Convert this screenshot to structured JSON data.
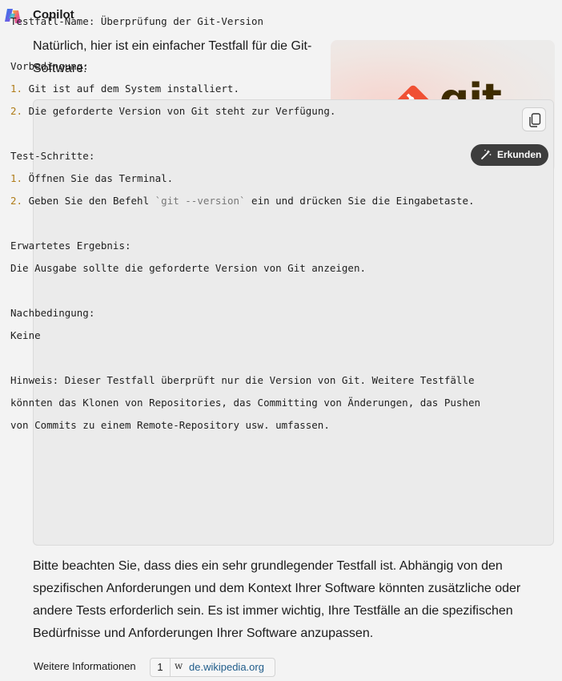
{
  "app": {
    "name": "Copilot",
    "logo_icon": "copilot-logo-icon"
  },
  "message": {
    "intro": "Natürlich, hier ist ein einfacher Testfall für die Git-Software:",
    "code_lines": [
      {
        "text": "Testfall-Name: Überprüfung der Git-Version"
      },
      {
        "text": ""
      },
      {
        "text": "Vorbedingung:"
      },
      {
        "num": "1.",
        "text": " Git ist auf dem System installiert."
      },
      {
        "num": "2.",
        "text": " Die geforderte Version von Git steht zur Verfügung."
      },
      {
        "text": ""
      },
      {
        "text": "Test-Schritte:"
      },
      {
        "num": "1.",
        "text": " Öffnen Sie das Terminal."
      },
      {
        "num": "2.",
        "text": " Geben Sie den Befehl ",
        "code": "`git --version`",
        "after": " ein und drücken Sie die Eingabetaste."
      },
      {
        "text": ""
      },
      {
        "text": "Erwartetes Ergebnis:"
      },
      {
        "text": "Die Ausgabe sollte die geforderte Version von Git anzeigen."
      },
      {
        "text": ""
      },
      {
        "text": "Nachbedingung:"
      },
      {
        "text": "Keine"
      },
      {
        "text": ""
      },
      {
        "text": "Hinweis: Dieser Testfall überprüft nur die Version von Git. Weitere Testfälle"
      },
      {
        "text": "könnten das Klonen von Repositories, das Committing von Änderungen, das Pushen"
      },
      {
        "text": "von Commits zu einem Remote-Repository usw. umfassen."
      }
    ],
    "outro": "Bitte beachten Sie, dass dies ein sehr grundlegender Testfall ist. Abhängig von den spezifischen Anforderungen und dem Kontext Ihrer Software könnten zusätzliche oder andere Tests erforderlich sein. Es ist immer wichtig, Ihre Testfälle an die spezifischen Bedürfnisse und Anforderungen Ihrer Software anzupassen."
  },
  "image_card": {
    "logo_text": "git",
    "explore_label": "Erkunden",
    "copy_icon": "copy-icon",
    "explore_icon": "magic-wand-icon"
  },
  "footer": {
    "more_label": "Weitere Informationen",
    "sources": [
      {
        "number": "1",
        "icon": "w",
        "domain": "de.wikipedia.org"
      }
    ]
  },
  "colors": {
    "background": "#f3f3f3",
    "code_background": "#ebebeb",
    "list_number": "#b07d1a",
    "git_orange": "#f05033",
    "button_dark": "#3d3d3d",
    "link": "#1f5c8a"
  }
}
